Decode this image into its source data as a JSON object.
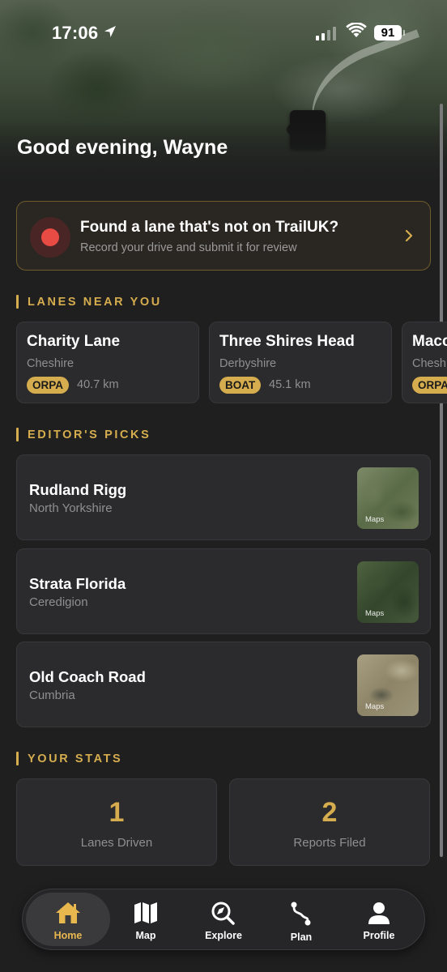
{
  "status_bar": {
    "time": "17:06",
    "battery": "91"
  },
  "header": {
    "greeting": "Good evening, Wayne"
  },
  "record_card": {
    "title": "Found a lane that's not on TrailUK?",
    "subtitle": "Record your drive and submit it for review"
  },
  "sections": {
    "near_you": "LANES NEAR YOU",
    "editors_picks": "EDITOR'S PICKS",
    "your_stats": "YOUR STATS"
  },
  "lanes_near_you": [
    {
      "name": "Charity Lane",
      "region": "Cheshire",
      "badge": "ORPA",
      "distance": "40.7 km"
    },
    {
      "name": "Three Shires Head",
      "region": "Derbyshire",
      "badge": "BOAT",
      "distance": "45.1 km"
    },
    {
      "name": "Macc",
      "region": "Chesh",
      "badge": "ORPA",
      "distance": ""
    }
  ],
  "editors_picks": [
    {
      "name": "Rudland Rigg",
      "region": "North Yorkshire",
      "map_label": "Maps"
    },
    {
      "name": "Strata Florida",
      "region": "Ceredigion",
      "map_label": "Maps"
    },
    {
      "name": "Old Coach Road",
      "region": "Cumbria",
      "map_label": "Maps"
    }
  ],
  "stats": [
    {
      "value": "1",
      "label": "Lanes Driven"
    },
    {
      "value": "2",
      "label": "Reports Filed"
    }
  ],
  "tabs": [
    {
      "label": "Home",
      "icon": "home-icon",
      "active": true
    },
    {
      "label": "Map",
      "icon": "map-icon",
      "active": false
    },
    {
      "label": "Explore",
      "icon": "explore-icon",
      "active": false
    },
    {
      "label": "Plan",
      "icon": "route-icon",
      "active": false
    },
    {
      "label": "Profile",
      "icon": "profile-icon",
      "active": false
    }
  ],
  "colors": {
    "accent": "#d6ad4e",
    "record_red": "#e84b43",
    "background": "#1f1f20",
    "card": "#2b2b2d"
  }
}
